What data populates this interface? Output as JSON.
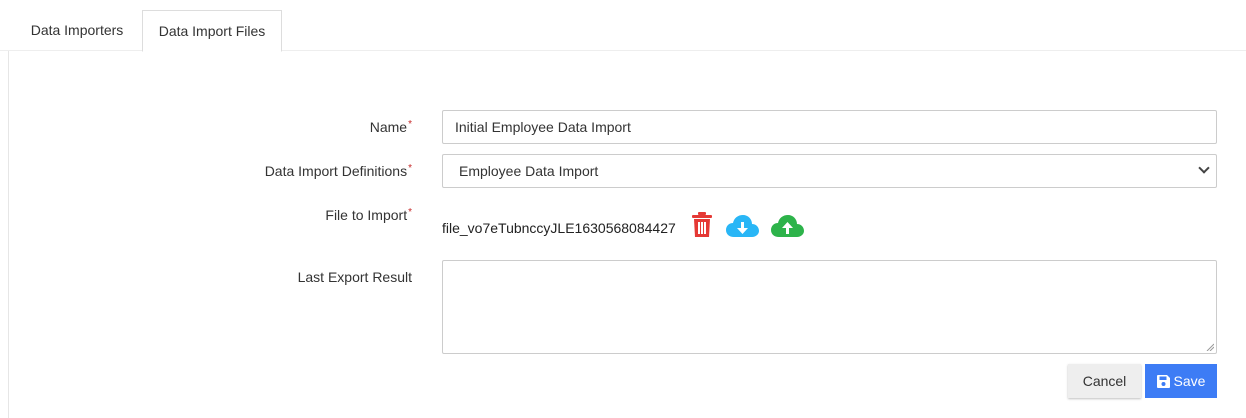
{
  "tabs": [
    {
      "label": "Data Importers",
      "active": false
    },
    {
      "label": "Data Import Files",
      "active": true
    }
  ],
  "form": {
    "required_marker": "*",
    "name_label": "Name",
    "name_value": "Initial Employee Data Import",
    "definitions_label": "Data Import Definitions",
    "definitions_value": "Employee Data Import",
    "file_label": "File to Import",
    "file_name": "file_vo7eTubnccyJLE1630568084427",
    "last_result_label": "Last Export Result",
    "last_result_value": ""
  },
  "icons": {
    "delete": "trash-icon",
    "download": "cloud-download-icon",
    "upload": "cloud-upload-icon",
    "save": "floppy-disk-icon"
  },
  "colors": {
    "required": "#c62828",
    "delete": "#e53935",
    "download": "#29b6f6",
    "upload": "#2db34a",
    "primary": "#3d7cf5"
  },
  "actions": {
    "cancel_label": "Cancel",
    "save_label": "Save"
  }
}
